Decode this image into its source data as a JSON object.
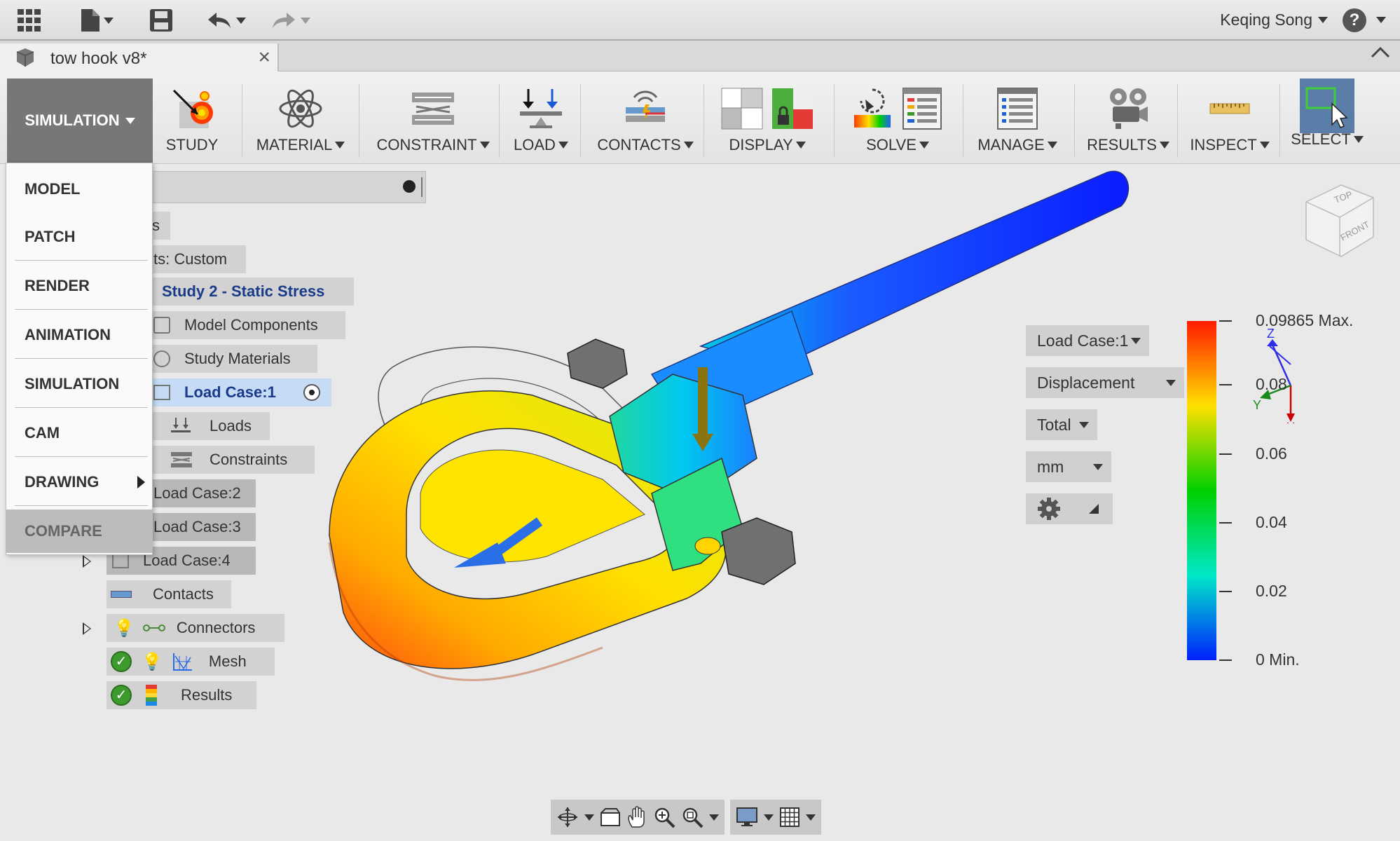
{
  "document": {
    "title": "tow hook v8*"
  },
  "user": {
    "name": "Keqing Song"
  },
  "help": {
    "label": "?"
  },
  "workspace": {
    "current": "SIMULATION",
    "menu": [
      "MODEL",
      "PATCH",
      "RENDER",
      "ANIMATION",
      "SIMULATION",
      "CAM",
      "DRAWING",
      "COMPARE"
    ]
  },
  "toolbar": {
    "study": "STUDY",
    "material": "MATERIAL",
    "constraint": "CONSTRAINT",
    "load": "LOAD",
    "contacts": "CONTACTS",
    "display": "DISPLAY",
    "solve": "SOLVE",
    "manage": "MANAGE",
    "results": "RESULTS",
    "inspect": "INSPECT",
    "select": "SELECT"
  },
  "browser": {
    "rows": {
      "r1": "s",
      "units": "ts: Custom",
      "study": "Study 2 - Static Stress",
      "model_components": "Model Components",
      "study_materials": "Study Materials",
      "load_case_1": "Load Case:1",
      "loads": "Loads",
      "constraints": "Constraints",
      "load_case_2": "Load Case:2",
      "load_case_3": "Load Case:3",
      "load_case_4": "Load Case:4",
      "contacts": "Contacts",
      "connectors": "Connectors",
      "mesh": "Mesh",
      "results": "Results"
    }
  },
  "results_panel": {
    "load_case": "Load Case:1",
    "result_type": "Displacement",
    "component": "Total",
    "units": "mm"
  },
  "legend": {
    "labels": [
      "0.09865 Max.",
      "0.08",
      "0.06",
      "0.04",
      "0.02",
      "0 Min."
    ],
    "fractions": [
      1.0,
      0.811,
      0.608,
      0.405,
      0.203,
      0.0
    ],
    "gradient": [
      "#ff1a00",
      "#ffe000",
      "#00d000",
      "#00e8c8",
      "#0020ff"
    ]
  },
  "viewcube": {
    "top": "TOP",
    "front": "FRONT"
  },
  "triad": {
    "x": "X",
    "y": "Y",
    "z": "Z"
  }
}
